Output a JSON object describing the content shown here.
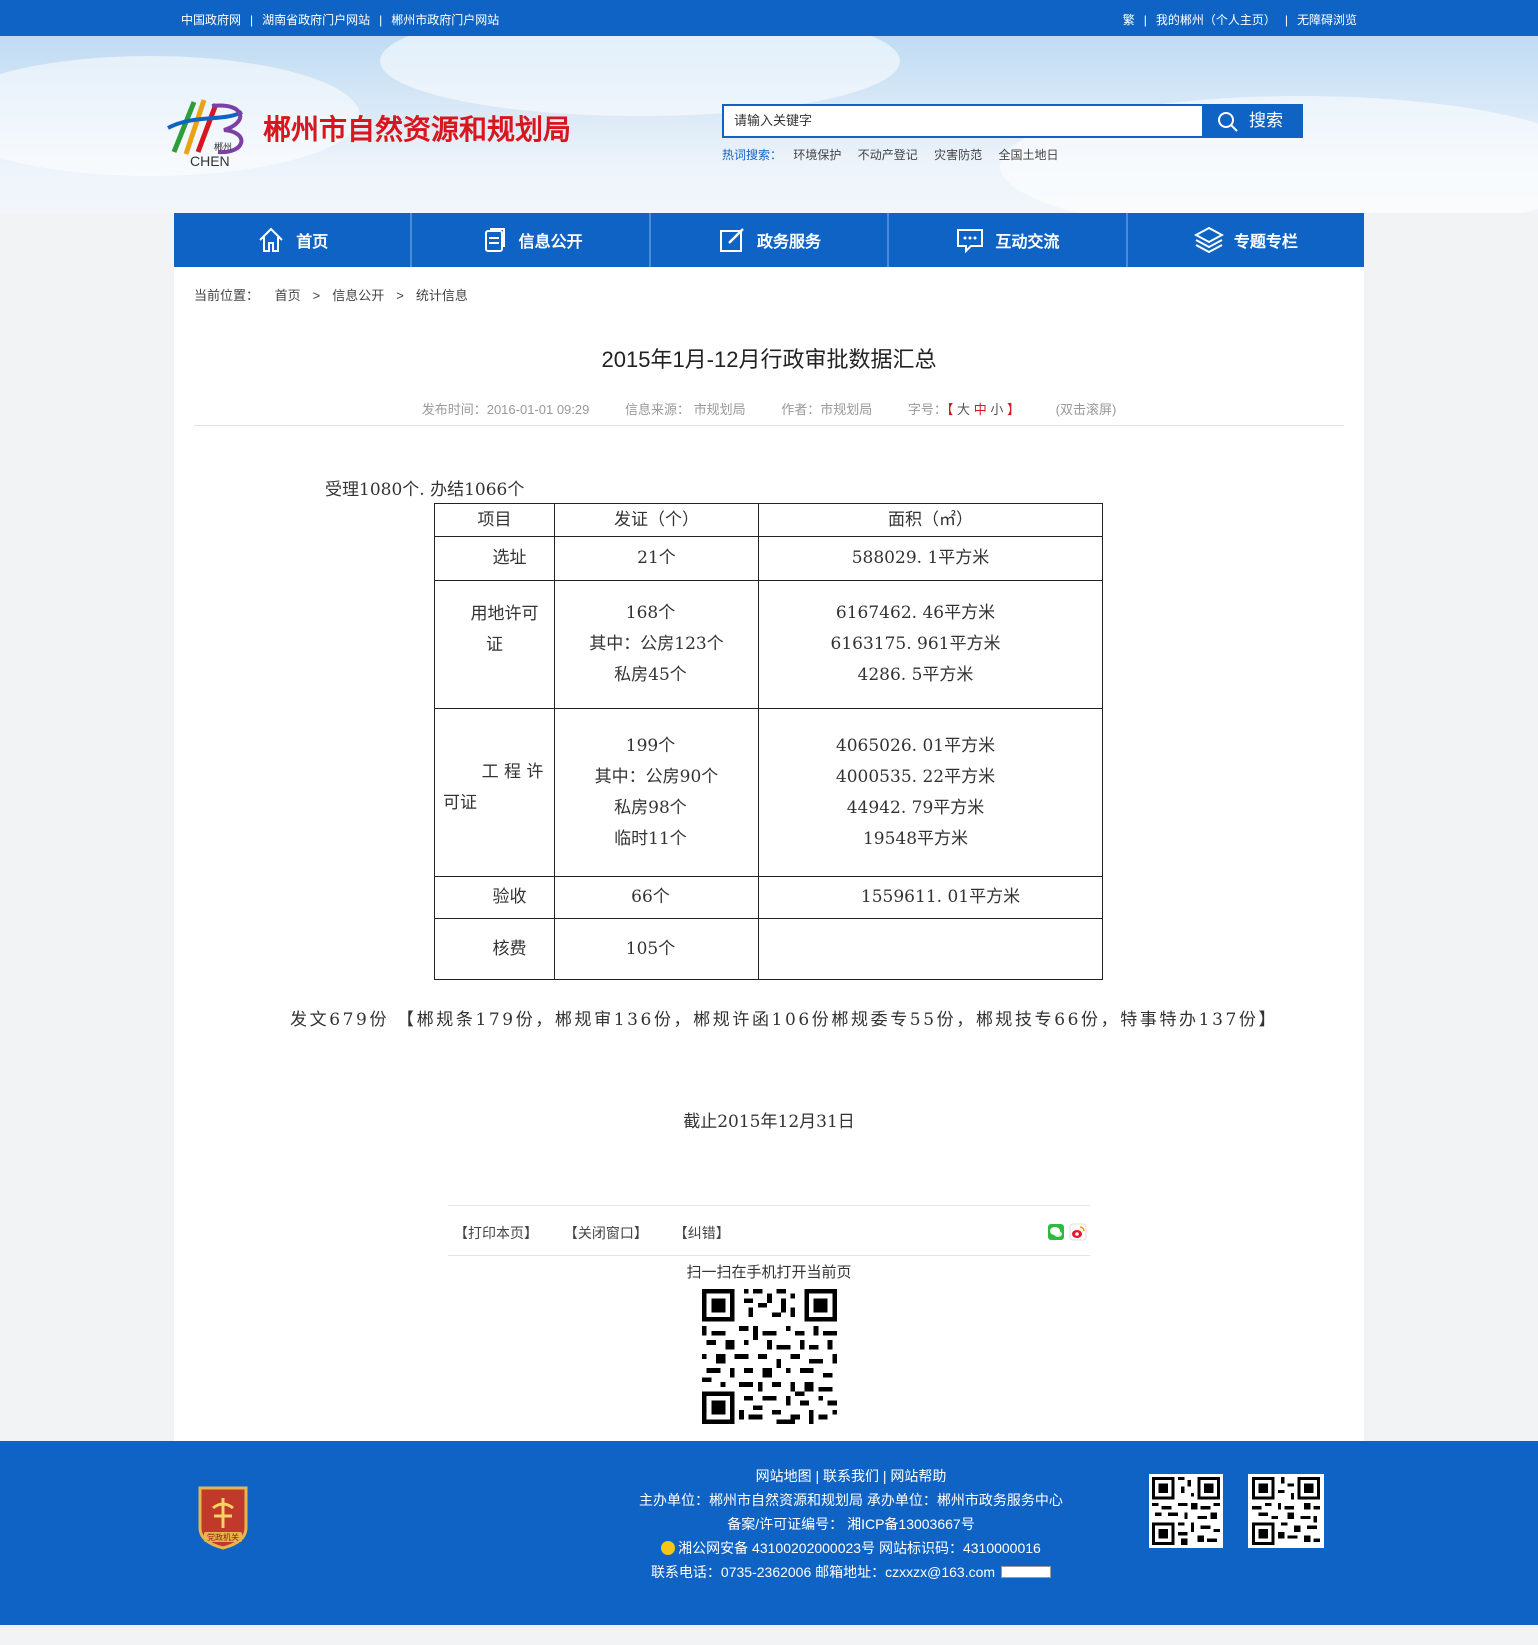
{
  "topbar": {
    "left_links": [
      "中国政府网",
      "湖南省政府门户网站",
      "郴州市政府门户网站"
    ],
    "right_links": [
      "繁",
      "我的郴州（个人主页）",
      "无障碍浏览"
    ],
    "sep": "|"
  },
  "header": {
    "site_name": "郴州市自然资源和规划局",
    "logo_text_small": "郴州",
    "logo_text_big": "CHEN",
    "search": {
      "placeholder": "请输入关键字",
      "button_label": "搜索"
    },
    "hot": {
      "label": "热词搜索：",
      "words": [
        "环境保护",
        "不动产登记",
        "灾害防范",
        "全国土地日"
      ]
    },
    "colors": {
      "brand_blue": "#0f63c5",
      "title_red": "#d7161d"
    }
  },
  "nav": {
    "items": [
      {
        "label": "首页",
        "icon": "home-icon"
      },
      {
        "label": "信息公开",
        "icon": "document-icon"
      },
      {
        "label": "政务服务",
        "icon": "edit-icon"
      },
      {
        "label": "互动交流",
        "icon": "chat-icon"
      },
      {
        "label": "专题专栏",
        "icon": "layers-icon"
      }
    ]
  },
  "breadcrumb": {
    "label": "当前位置：",
    "items": [
      "首页",
      "信息公开",
      "统计信息"
    ],
    "sep": ">"
  },
  "article": {
    "title": "2015年1月-12月行政审批数据汇总",
    "meta": {
      "publish": "发布时间：2016-01-01 09:29",
      "source": "信息来源： 市规划局",
      "author": "作者：市规划局",
      "font_label": "字号：",
      "bracket_open": "【",
      "big": "大",
      "mid": "中",
      "small": "小",
      "bracket_close": "】",
      "dblclick": "(双击滚屏)"
    },
    "intro": "受理1080个. 办结1066个",
    "table": {
      "headers": [
        "项目",
        "发证（个）",
        "面积（㎡）"
      ],
      "rows": [
        {
          "item": [
            "选址"
          ],
          "count": [
            "21个"
          ],
          "area": [
            "588029. 1平方米"
          ]
        },
        {
          "item": [
            "用地许可",
            "证"
          ],
          "count": [
            "168个",
            "其中：公房123个",
            "私房45个"
          ],
          "area": [
            "6167462. 46平方米",
            "6163175. 961平方米",
            "4286. 5平方米"
          ]
        },
        {
          "item": [
            "工 程 许",
            "可证"
          ],
          "count": [
            "199个",
            "其中：公房90个",
            "私房98个",
            "临时11个"
          ],
          "area": [
            "4065026. 01平方米",
            "4000535. 22平方米",
            "44942. 79平方米",
            "19548平方米"
          ]
        },
        {
          "item": [
            "验收"
          ],
          "count": [
            "66个"
          ],
          "area": [
            "1559611. 01平方米"
          ]
        },
        {
          "item": [
            "核费"
          ],
          "count": [
            "105个"
          ],
          "area": []
        }
      ]
    },
    "fawen": "发文679份  【郴规条179份，郴规审136份，郴规许函106份郴规委专55份，郴规技专66份，特事特办137份】",
    "deadline": "截止2015年12月31日",
    "tools": [
      "【打印本页】",
      "【关闭窗口】",
      "【纠错】"
    ],
    "scan": "扫一扫在手机打开当前页"
  },
  "footer": {
    "links": [
      "网站地图",
      "联系我们",
      "网站帮助"
    ],
    "sponsor": "主办单位：郴州市自然资源和规划局    承办单位：郴州市政务服务中心",
    "icp": "备案/许可证编号： 湘ICP备13003667号",
    "police": "湘公网安备 43100202000023号    网站标识码：4310000016",
    "contact": "联系电话：0735-2362006    邮箱地址：czxxzx@163.com",
    "emblem_text": "党政机关"
  }
}
